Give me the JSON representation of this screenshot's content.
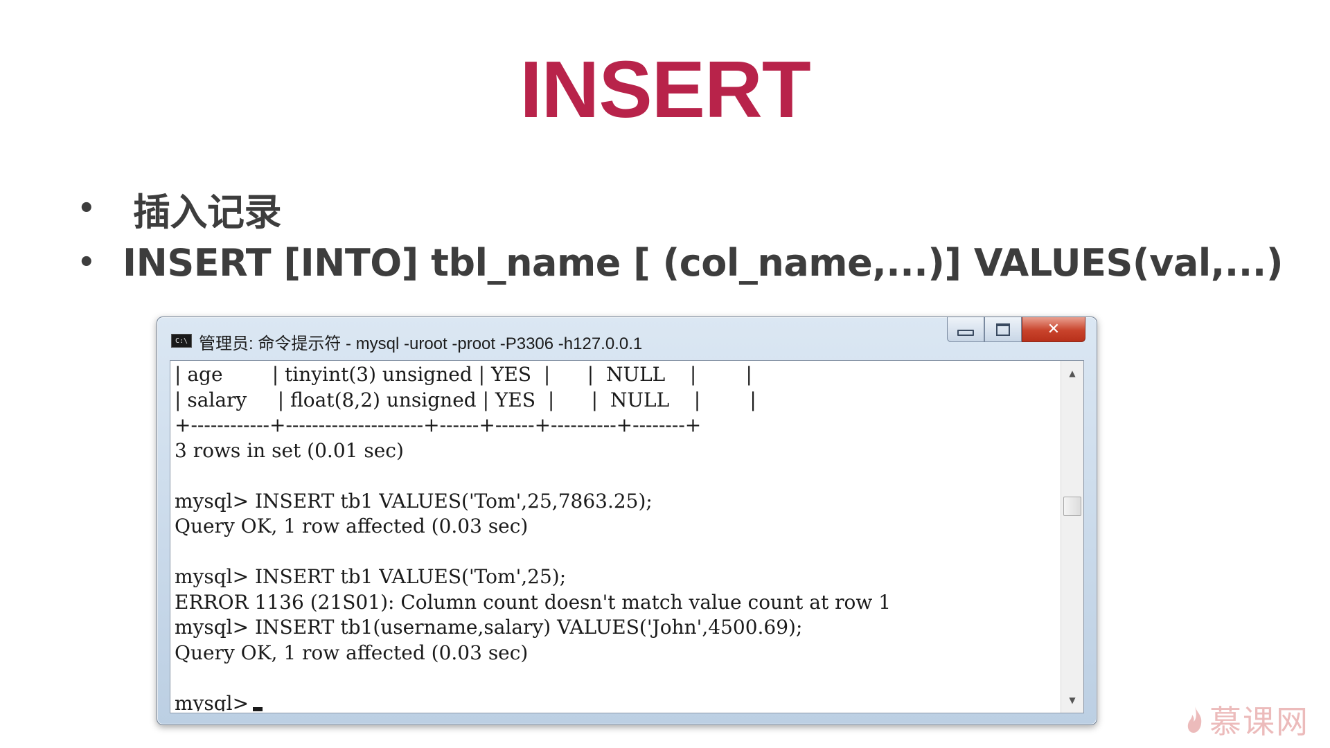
{
  "slide": {
    "title": "INSERT",
    "bullets": [
      "插入记录",
      "INSERT [INTO] tbl_name [ (col_name,...)] VALUES(val,...)"
    ]
  },
  "window": {
    "icon_label": "C:\\",
    "title": "管理员: 命令提示符 - mysql  -uroot -proot -P3306 -h127.0.0.1",
    "controls": {
      "minimize": "minimize-icon",
      "maximize": "maximize-icon",
      "close": "✕"
    }
  },
  "console": {
    "lines": [
      "| age        | tinyint(3) unsigned | YES  |      |  NULL    |        |",
      "| salary     | float(8,2) unsigned | YES  |      |  NULL    |        |",
      "+------------+---------------------+------+------+----------+--------+",
      "3 rows in set (0.01 sec)",
      "",
      "mysql> INSERT tb1 VALUES('Tom',25,7863.25);",
      "Query OK, 1 row affected (0.03 sec)",
      "",
      "mysql> INSERT tb1 VALUES('Tom',25);",
      "ERROR 1136 (21S01): Column count doesn't match value count at row 1",
      "mysql> INSERT tb1(username,salary) VALUES('John',4500.69);",
      "Query OK, 1 row affected (0.03 sec)",
      "",
      "mysql>"
    ]
  },
  "watermark": {
    "text": "慕课网"
  }
}
